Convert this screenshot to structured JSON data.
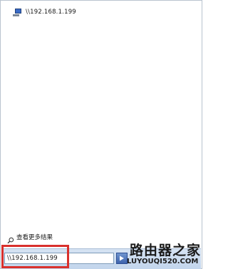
{
  "results": {
    "items": [
      {
        "label": "\\\\192.168.1.199",
        "icon": "network-computer-icon"
      }
    ]
  },
  "see_more": {
    "label": "查看更多结果",
    "icon": "magnifier-icon"
  },
  "search": {
    "value": "\\\\192.168.1.199",
    "go_icon": "arrow-right-icon"
  },
  "highlight": {
    "color": "#d9302c"
  },
  "watermark": {
    "title": "路由器之家",
    "url": "LUYOUQI520.COM"
  }
}
